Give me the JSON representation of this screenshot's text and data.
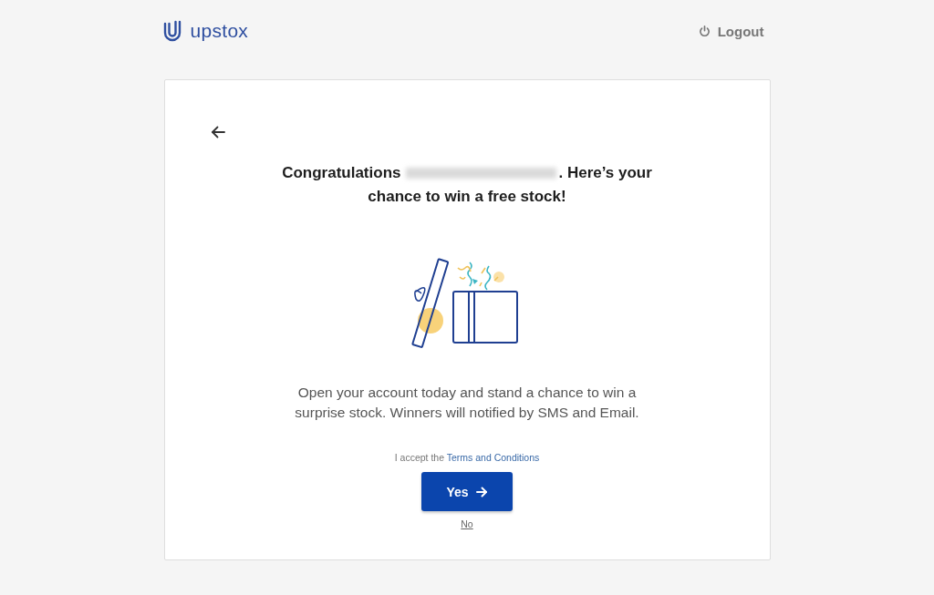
{
  "header": {
    "brand": "upstox",
    "logout": "Logout"
  },
  "card": {
    "heading": {
      "before": "Congratulations",
      "after": ". Here’s your",
      "line_2": "chance to win a free stock!"
    },
    "message": "Open your account today and stand a chance to win a surprise stock. Winners will notified by SMS and Email.",
    "terms": {
      "prefix": "I accept the",
      "link": "Terms and Conditions"
    },
    "yes_button": "Yes",
    "no_link": "No"
  }
}
